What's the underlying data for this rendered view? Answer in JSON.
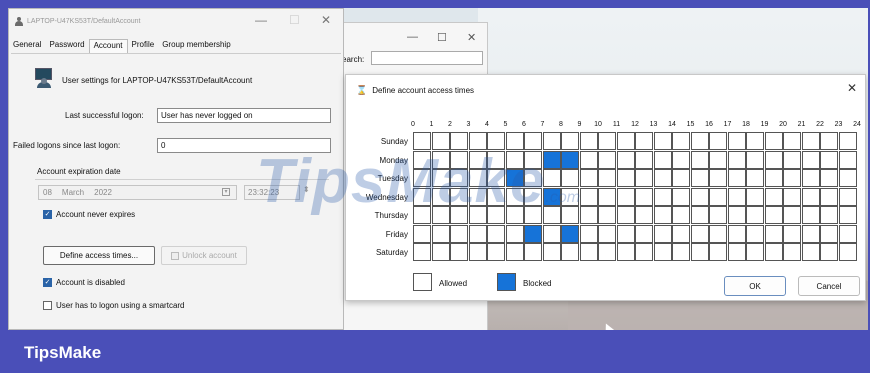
{
  "properties_window": {
    "title": "LAPTOP-U47KS53T/DefaultAccount",
    "tabs": [
      "General",
      "Password",
      "Account",
      "Profile",
      "Group membership"
    ],
    "active_tab": "Account",
    "settings_for": "User settings for LAPTOP-U47KS53T/DefaultAccount",
    "last_logon_label": "Last successful logon:",
    "last_logon_value": "User has never logged on",
    "failed_logons_label": "Failed logons since last logon:",
    "failed_logons_value": "0",
    "expiration_group_label": "Account expiration date",
    "date_day": "08",
    "date_month": "March",
    "date_year": "2022",
    "time_value": "23:32:23",
    "never_expires_label": "Account never expires",
    "never_expires_checked": true,
    "define_access_button": "Define access times...",
    "unlock_button": "Unlock account",
    "disabled_label": "Account is disabled",
    "disabled_checked": true,
    "smartcard_label": "User has to logon using a smartcard",
    "smartcard_checked": false
  },
  "back_window": {
    "search_label": "earch:"
  },
  "access_dialog": {
    "title": "Define account access times",
    "hours": [
      "0",
      "1",
      "2",
      "3",
      "4",
      "5",
      "6",
      "7",
      "8",
      "9",
      "10",
      "11",
      "12",
      "13",
      "14",
      "15",
      "16",
      "17",
      "18",
      "19",
      "20",
      "21",
      "22",
      "23",
      "24"
    ],
    "days": [
      "Sunday",
      "Monday",
      "Tuesday",
      "Wednesday",
      "Thursday",
      "Friday",
      "Saturday"
    ],
    "blocked": [
      [
        1,
        7
      ],
      [
        1,
        8
      ],
      [
        2,
        5
      ],
      [
        3,
        7
      ],
      [
        5,
        6
      ],
      [
        5,
        8
      ]
    ],
    "legend_allowed": "Allowed",
    "legend_blocked": "Blocked",
    "ok_button": "OK",
    "cancel_button": "Cancel",
    "blocked_color": "#1673d8"
  },
  "watermark": {
    "text": "TipsMake",
    "suffix": ".com"
  },
  "footer": {
    "brand": "TipsMake"
  }
}
